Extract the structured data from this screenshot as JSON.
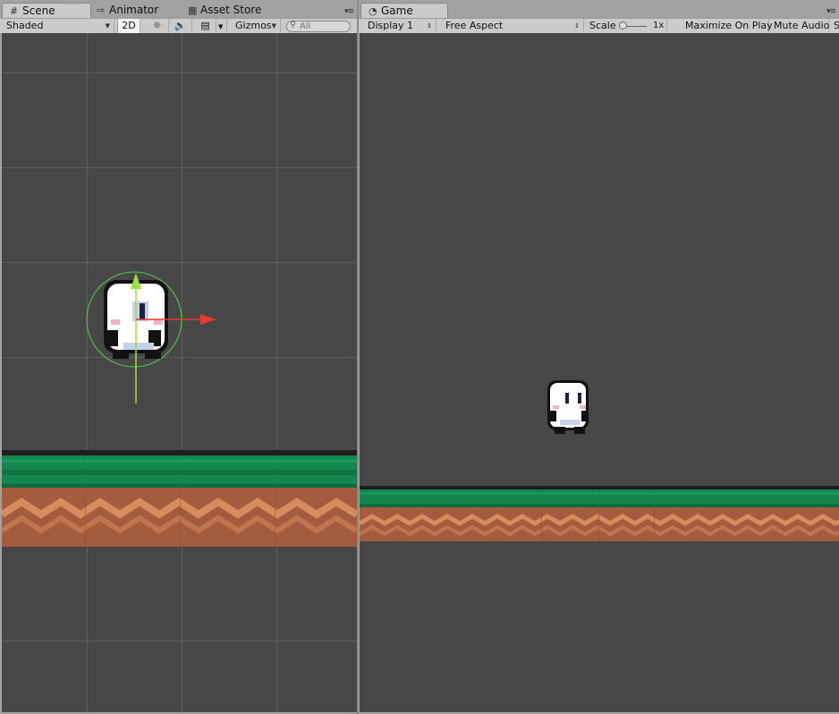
{
  "scene_panel": {
    "tabs": [
      {
        "icon": "grid-icon",
        "label": "Scene",
        "active": true
      },
      {
        "icon": "animator-icon",
        "label": "Animator",
        "active": false
      },
      {
        "icon": "store-icon",
        "label": "Asset Store",
        "active": false
      }
    ],
    "toolbar": {
      "draw_mode": "Shaded",
      "mode_2d": "2D",
      "gizmos_label": "Gizmos",
      "search_placeholder": "All"
    }
  },
  "game_panel": {
    "tabs": [
      {
        "icon": "pacman-icon",
        "label": "Game",
        "active": true
      }
    ],
    "toolbar": {
      "display": "Display 1",
      "aspect": "Free Aspect",
      "scale_label": "Scale",
      "scale_value": "1x",
      "maximize_on_play": "Maximize On Play",
      "mute_audio": "Mute Audio",
      "stats_truncated": "S"
    }
  },
  "colors": {
    "viewport_bg": "#474747",
    "grass": "#13854d",
    "dirt": "#a55c3e",
    "dirt_stripe": "#d88b5d",
    "gizmo_y": "#9be23a",
    "gizmo_x": "#e63b2a",
    "collider": "#4fd24a"
  }
}
